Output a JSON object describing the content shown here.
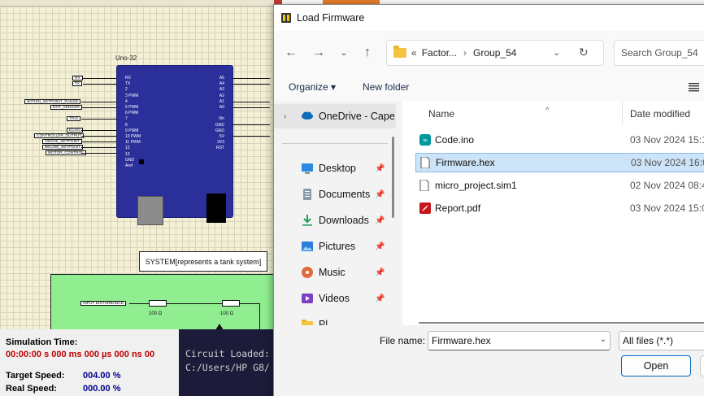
{
  "simulator": {
    "board_title": "Uno-32",
    "left_pins": [
      "RX",
      "TX",
      "2",
      "3 PWM",
      "4",
      "5 PWM",
      "6 PWM",
      "7",
      "8",
      "9 PWM",
      "10 PWM",
      "11 PWM",
      "12",
      "13",
      "GND",
      "Aref"
    ],
    "right_pins": [
      "A5",
      "A4",
      "A3",
      "A2",
      "A1",
      "A0",
      "",
      "Vin",
      "GND",
      "GND",
      "5V",
      "3V3",
      "RST"
    ],
    "net_labels": [
      "RX",
      "TX",
      "WITHIN_SETPOINT_RANGE",
      "DHT_SENSOR",
      "TRIG",
      "ECHO",
      "CONTROLLER_OUTPUT",
      "ABOVE_SETPOINT",
      "BELOW_SETPOINT",
      "MOTOR_CONTROL"
    ],
    "system_label": "SYSTEM[represents a tank system]",
    "input_label": "INPUT DISTURBANCE",
    "resistor1": "100 Ω",
    "resistor2": "100 Ω"
  },
  "status": {
    "sim_time_label": "Simulation Time:",
    "sim_time_value": "00:00:00 s  000 ms  000 µs  000 ns  00",
    "target_label": "Target Speed:",
    "target_value": "004.00 %",
    "real_label": "Real Speed:",
    "real_value": "000.00 %"
  },
  "console": {
    "line1": "Circuit Loaded:",
    "line2": "C:/Users/HP G8/"
  },
  "dialog": {
    "title": "Load Firmware",
    "address": {
      "prefix": "«",
      "part1": "Factor...",
      "sep": "›",
      "part2": "Group_54"
    },
    "search_placeholder": "Search Group_54",
    "organize_label": "Organize ▾",
    "new_folder_label": "New folder",
    "sidebar": {
      "onedrive": "OneDrive - Cape",
      "items": [
        {
          "label": "Desktop",
          "icon": "desktop-icon"
        },
        {
          "label": "Documents",
          "icon": "documents-icon"
        },
        {
          "label": "Downloads",
          "icon": "downloads-icon"
        },
        {
          "label": "Pictures",
          "icon": "pictures-icon"
        },
        {
          "label": "Music",
          "icon": "music-icon"
        },
        {
          "label": "Videos",
          "icon": "videos-icon"
        },
        {
          "label": "Pl",
          "icon": "folder-icon"
        }
      ]
    },
    "columns": {
      "name": "Name",
      "date": "Date modified"
    },
    "files": [
      {
        "name": "Code.ino",
        "date": "03 Nov 2024 15:13",
        "icon": "arduino-icon",
        "selected": false
      },
      {
        "name": "Firmware.hex",
        "date": "03 Nov 2024 16:05",
        "icon": "file-icon",
        "selected": true
      },
      {
        "name": "micro_project.sim1",
        "date": "02 Nov 2024 08:41",
        "icon": "file-icon",
        "selected": false
      },
      {
        "name": "Report.pdf",
        "date": "03 Nov 2024 15:06",
        "icon": "pdf-icon",
        "selected": false
      }
    ],
    "file_name_label": "File name:",
    "file_name_value": "Firmware.hex",
    "file_type_value": "All files (*.*)",
    "open_label": "Open"
  }
}
